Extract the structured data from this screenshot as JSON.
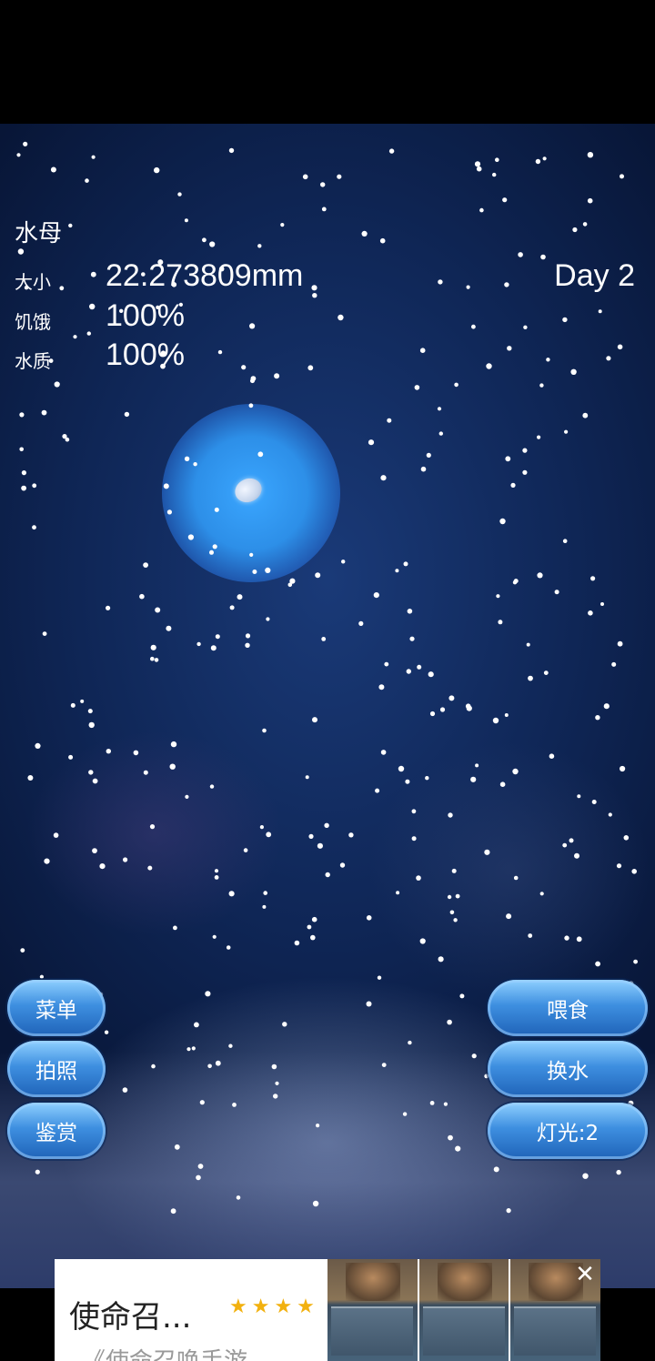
{
  "stats": {
    "title": "水母",
    "size_label": "大小",
    "size_value": "22.273809mm",
    "hunger_label": "饥饿",
    "hunger_value": "100%",
    "water_label": "水质",
    "water_value": "100%",
    "day": "Day 2"
  },
  "buttons": {
    "menu": "菜单",
    "photo": "拍照",
    "appreciate": "鉴赏",
    "feed": "喂食",
    "change_water": "换水",
    "light": "灯光:2"
  },
  "ad": {
    "title": "使命召...",
    "subtitle": "《使命召唤手游",
    "rating_stars": 4
  }
}
